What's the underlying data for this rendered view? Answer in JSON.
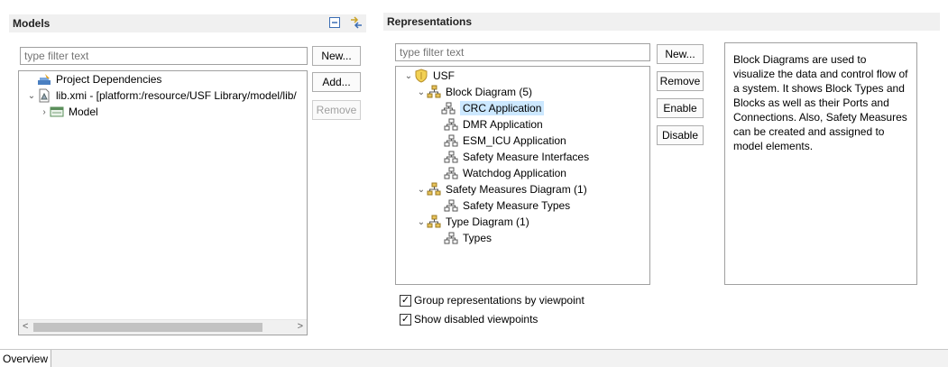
{
  "models": {
    "title": "Models",
    "filter_placeholder": "type filter text",
    "buttons": {
      "new": "New...",
      "add": "Add...",
      "remove": "Remove"
    },
    "tree": [
      {
        "label": "Project Dependencies",
        "icon": "project-dependencies-icon"
      },
      {
        "label": "lib.xmi - [platform:/resource/USF Library/model/lib/",
        "icon": "xmi-resource-icon",
        "expanded": true
      },
      {
        "label": "Model",
        "icon": "model-icon",
        "expanded": false
      }
    ]
  },
  "representations": {
    "title": "Representations",
    "filter_placeholder": "type filter text",
    "buttons": {
      "new": "New...",
      "remove": "Remove",
      "enable": "Enable",
      "disable": "Disable"
    },
    "tree": {
      "root": "USF",
      "groups": [
        {
          "label": "Block Diagram (5)",
          "items": [
            "CRC Application",
            "DMR Application",
            "ESM_ICU Application",
            "Safety Measure Interfaces",
            "Watchdog Application"
          ]
        },
        {
          "label": "Safety Measures Diagram (1)",
          "items": [
            "Safety Measure Types"
          ]
        },
        {
          "label": "Type Diagram (1)",
          "items": [
            "Types"
          ]
        }
      ],
      "selected": "CRC Application"
    },
    "description": "Block Diagrams are used to visualize the data and control flow of a system. It shows Block Types and Blocks as well as their Ports and Connections. Also, Safety Measures can be created and assigned to model elements.",
    "options": {
      "group_by_viewpoint": {
        "label": "Group representations by viewpoint",
        "checked": true
      },
      "show_disabled": {
        "label": "Show disabled viewpoints",
        "checked": true
      }
    }
  },
  "tabs": {
    "overview": "Overview"
  },
  "colors": {
    "selection": "#cce8ff",
    "header_bg": "#f0f0f0",
    "border": "#a0a0a0"
  }
}
